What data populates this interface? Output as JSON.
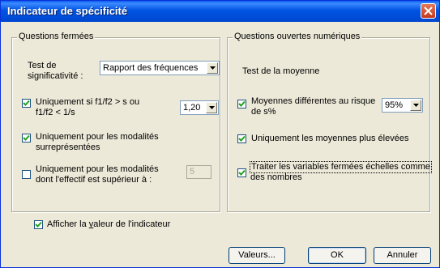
{
  "window": {
    "title": "Indicateur de spécificité"
  },
  "closed_questions": {
    "group_title": "Questions fermées",
    "test_label_1": "Test de",
    "test_label_2": "significativité :",
    "test_value": "Rapport des fréquences",
    "ratio_checked": true,
    "ratio_label_1": "Uniquement si f1/f2 > s ou",
    "ratio_label_2": "f1/f2 < 1/s",
    "ratio_value": "1,20",
    "overrep_checked": true,
    "overrep_label_1": "Uniquement pour les modalités",
    "overrep_label_2": "surreprésentées",
    "effectif_checked": false,
    "effectif_label_1": "Uniquement pour les modalités",
    "effectif_label_2": "dont l'effectif est supérieur à :",
    "effectif_value": "5"
  },
  "open_questions": {
    "group_title": "Questions ouvertes numériques",
    "test_label": "Test de la moyenne",
    "means_checked": true,
    "means_label_1": "Moyennes différentes au risque",
    "means_label_2": "de s%",
    "risk_value": "95%",
    "higher_checked": true,
    "higher_label": "Uniquement les moyennes plus élevées",
    "scales_checked": true,
    "scales_label_1": "Traiter les variables fermées échelles comme",
    "scales_label_2": "des nombres"
  },
  "show_value": {
    "checked": true,
    "label_before": "Afficher la ",
    "label_underlined": "v",
    "label_after": "aleur de l'indicateur"
  },
  "buttons": {
    "values": "Valeurs...",
    "ok": "OK",
    "cancel": "Annuler"
  }
}
